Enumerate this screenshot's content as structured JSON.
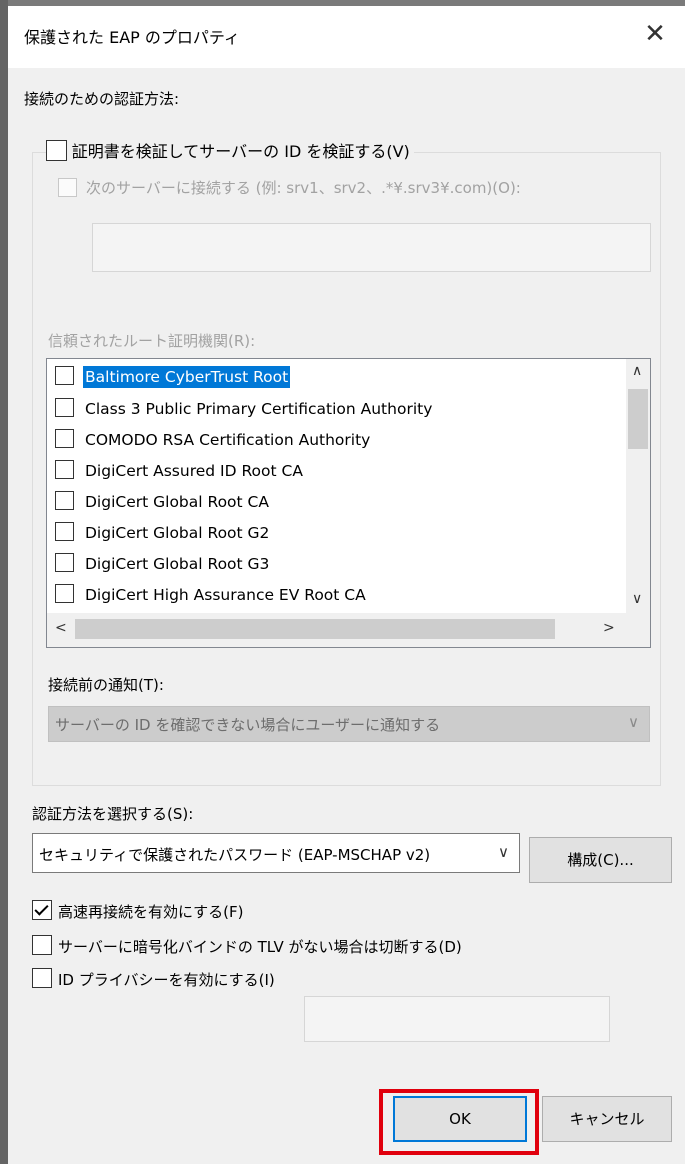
{
  "window": {
    "title": "保護された EAP のプロパティ",
    "close_glyph": "✕"
  },
  "connect_auth_label": "接続のための認証方法:",
  "verify_server": {
    "label": "証明書を検証してサーバーの ID を検証する(V)",
    "checked": false
  },
  "connect_servers": {
    "label": "次のサーバーに接続する (例: srv1、srv2、.*¥.srv3¥.com)(O):",
    "value": ""
  },
  "trusted_root_label": "信頼されたルート証明機関(R):",
  "cert_list": [
    {
      "name": "Baltimore CyberTrust Root",
      "selected": true
    },
    {
      "name": "Class 3 Public Primary Certification Authority"
    },
    {
      "name": "COMODO RSA Certification Authority"
    },
    {
      "name": "DigiCert Assured ID Root CA"
    },
    {
      "name": "DigiCert Global Root CA"
    },
    {
      "name": "DigiCert Global Root G2"
    },
    {
      "name": "DigiCert Global Root G3"
    },
    {
      "name": "DigiCert High Assurance EV Root CA"
    }
  ],
  "scroll_glyphs": {
    "up": "∧",
    "down": "∨",
    "left": "<",
    "right": ">"
  },
  "notify_label": "接続前の通知(T):",
  "notify_combo": {
    "value": "サーバーの ID を確認できない場合にユーザーに通知する",
    "chevron": "∨"
  },
  "auth_method_label": "認証方法を選択する(S):",
  "auth_method_combo": {
    "value": "セキュリティで保護されたパスワード (EAP-MSCHAP v2)",
    "chevron": "∨"
  },
  "configure_button": "構成(C)...",
  "fast_reconnect": {
    "label": "高速再接続を有効にする(F)",
    "checked": true
  },
  "disconnect_tlv": {
    "label": "サーバーに暗号化バインドの TLV がない場合は切断する(D)",
    "checked": false
  },
  "id_privacy": {
    "label": "ID プライバシーを有効にする(I)",
    "checked": false,
    "value": ""
  },
  "ok_button": "OK",
  "cancel_button": "キャンセル",
  "colors": {
    "highlight": "#e0000d",
    "selection": "#0078d7",
    "default_button_border": "#0078d7"
  }
}
